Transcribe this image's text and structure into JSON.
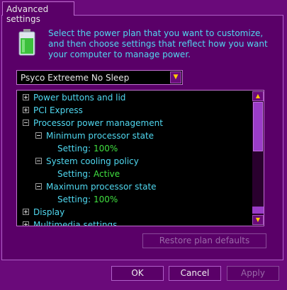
{
  "tab": {
    "label": "Advanced settings"
  },
  "intro": {
    "text": "Select the power plan that you want to customize, and then choose settings that reflect how you want your computer to manage power."
  },
  "plan_select": {
    "value": "Psyco Extreeme No Sleep",
    "arrow": "▼"
  },
  "tree": {
    "items": [
      {
        "label": "Power buttons and lid",
        "expander": "plus"
      },
      {
        "label": "PCI Express",
        "expander": "plus"
      },
      {
        "label": "Processor power management",
        "expander": "minus"
      },
      {
        "label": "Minimum processor state",
        "expander": "minus"
      },
      {
        "setting_label": "Setting:",
        "value": "100%"
      },
      {
        "label": "System cooling policy",
        "expander": "minus"
      },
      {
        "setting_label": "Setting:",
        "value": "Active"
      },
      {
        "label": "Maximum processor state",
        "expander": "minus"
      },
      {
        "setting_label": "Setting:",
        "value": "100%"
      },
      {
        "label": "Display",
        "expander": "plus"
      },
      {
        "label": "Multimedia settings",
        "expander": "plus"
      }
    ]
  },
  "scrollbar": {
    "up": "▲",
    "down": "▼"
  },
  "buttons": {
    "restore": "Restore plan defaults",
    "ok": "OK",
    "cancel": "Cancel",
    "apply": "Apply"
  },
  "colors": {
    "background": "#6a0a7a",
    "panel": "#5a0068",
    "text_cyan": "#50d8f0",
    "text_green": "#40e040",
    "arrow_yellow": "#ffcc00"
  },
  "icons": {
    "power": "battery-power-icon"
  }
}
